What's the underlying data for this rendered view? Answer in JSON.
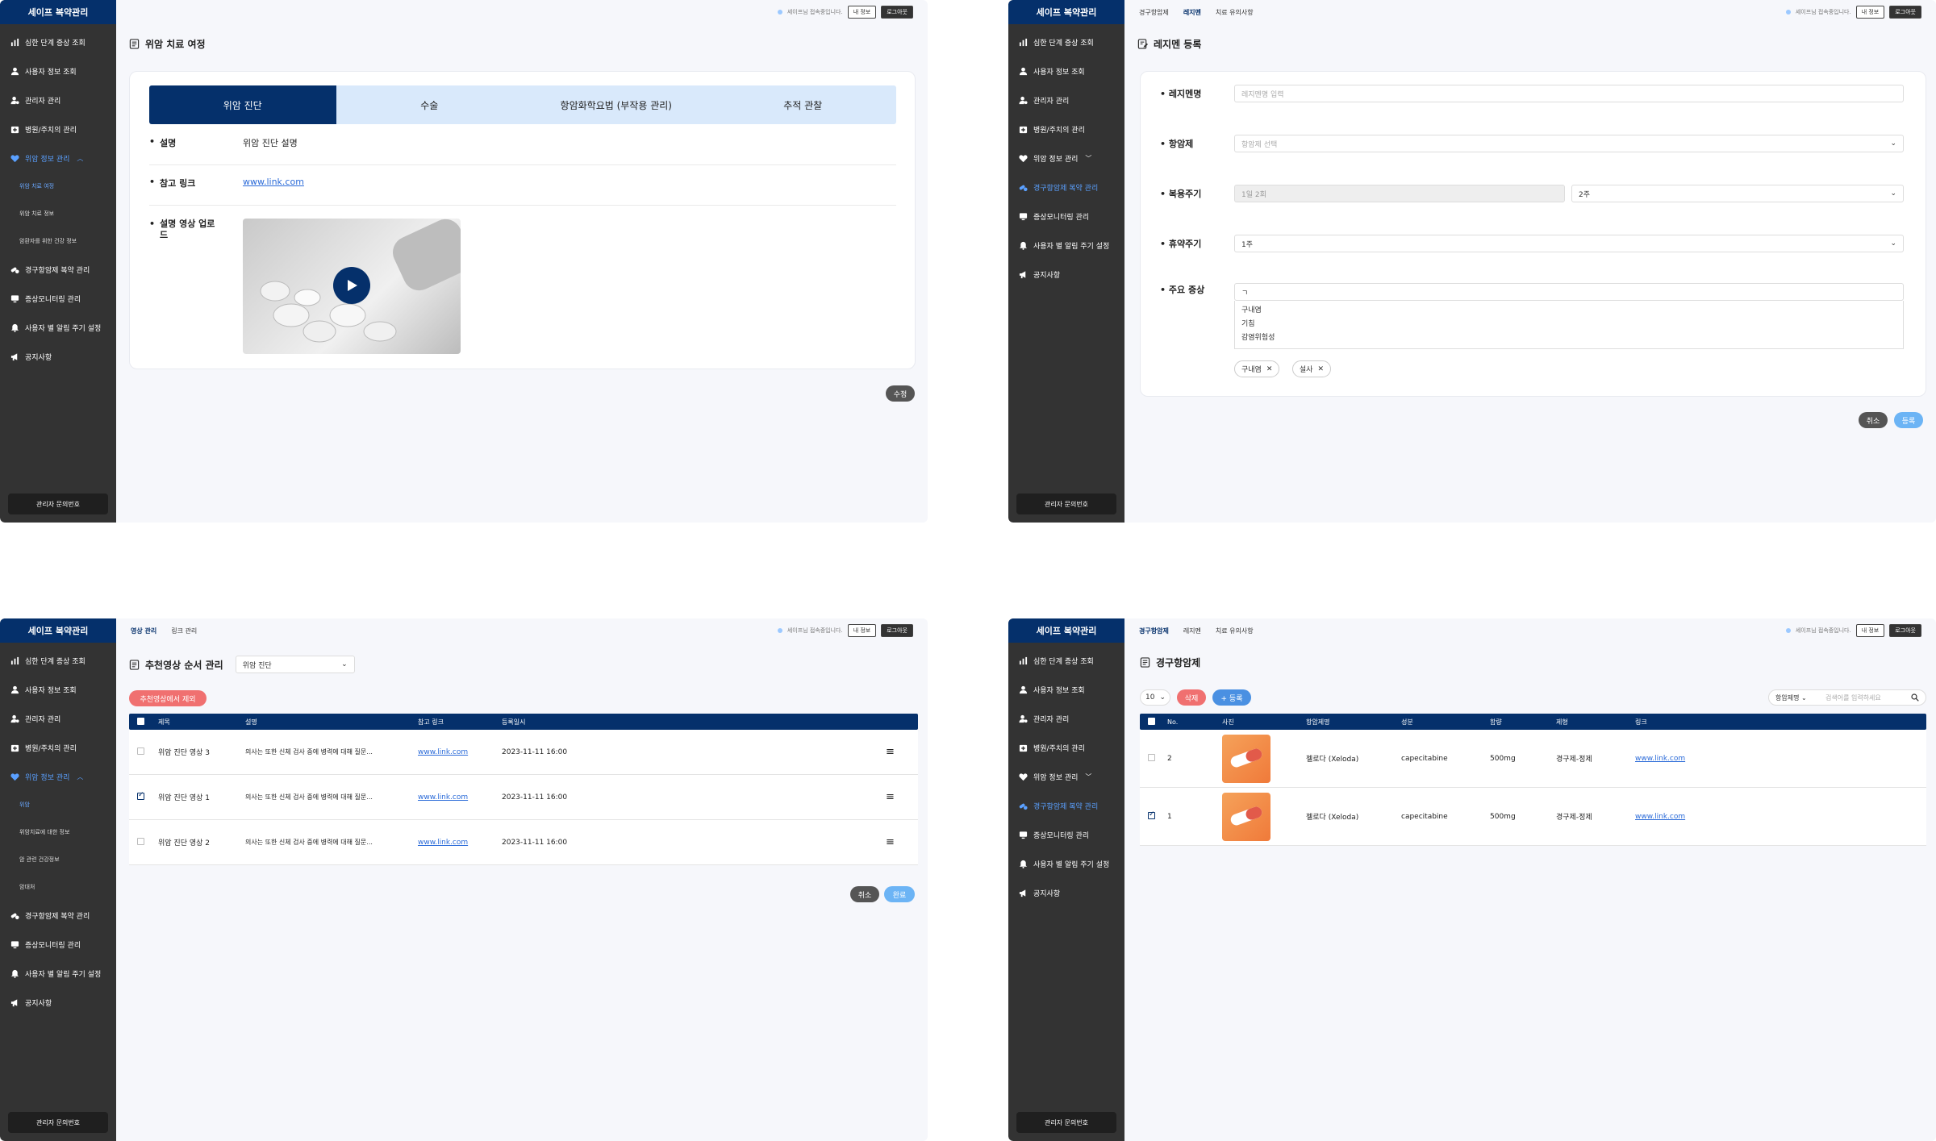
{
  "sidebar": {
    "brand": "세이프 복약관리",
    "items": [
      {
        "label": "심한 단계 증상 조회"
      },
      {
        "label": "사용자 정보 조회"
      },
      {
        "label": "관리자 관리"
      },
      {
        "label": "병원/주치의 관리"
      },
      {
        "label": "위암 정보 관리"
      },
      {
        "label": "경구항암제 복약 관리"
      },
      {
        "label": "증상모니터링 관리"
      },
      {
        "label": "사용자 별 알림 주기 설정"
      },
      {
        "label": "공지사항"
      }
    ],
    "submenu_p1": [
      "위암 치료 여정",
      "위암 치료 정보",
      "암환자를 위한 건강 정보"
    ],
    "submenu_p3": [
      "위암",
      "위암치료에 대한 정보",
      "암 관련 건강정보",
      "암대처"
    ],
    "footer": "관리자 문의번호"
  },
  "header": {
    "status": "세이프님 접속중입니다.",
    "my_info": "내 정보",
    "logout": "로그아웃"
  },
  "panel1": {
    "title": "위암 치료 여정",
    "tabs": [
      "위암 진단",
      "수술",
      "항암화학요법 (부작용 관리)",
      "추적 관찰"
    ],
    "desc_label": "설명",
    "desc_value": "위암 진단 설명",
    "link_label": "참고 링크",
    "link_value": "www.link.com",
    "video_label": "설명 영상 업로드",
    "edit": "수정"
  },
  "panel2": {
    "tabs": [
      "경구항암제",
      "레지멘",
      "치료 유의사항"
    ],
    "title": "레지멘 등록",
    "regimen_label": "레지멘명",
    "regimen_placeholder": "레지멘명 입력",
    "drug_label": "항암제",
    "drug_placeholder": "항암제 선택",
    "cycle_label": "복용주기",
    "cycle_value": "1일 2회",
    "cycle_select": "2주",
    "rest_label": "휴약주기",
    "rest_select": "1주",
    "symptom_label": "주요 증상",
    "symptom_input": "ㄱ",
    "suggestions": [
      "구내염",
      "기침",
      "감염위험성"
    ],
    "chips": [
      "구내염",
      "설사"
    ],
    "cancel": "취소",
    "submit": "등록"
  },
  "panel3": {
    "tabs": [
      "영상 관리",
      "링크 관리"
    ],
    "title": "추천영상 순서 관리",
    "select": "위암 진단",
    "exclude": "추천영상에서 제외",
    "columns": [
      "제목",
      "설명",
      "참고 링크",
      "등록일시"
    ],
    "rows": [
      {
        "title": "위암 진단 영상 3",
        "desc": "의사는 또한 신체 검사 중에 병력에 대해 질문...",
        "link": "www.link.com",
        "date": "2023-11-11 16:00",
        "checked": false
      },
      {
        "title": "위암 진단 영상 1",
        "desc": "의사는 또한 신체 검사 중에 병력에 대해 질문...",
        "link": "www.link.com",
        "date": "2023-11-11 16:00",
        "checked": true
      },
      {
        "title": "위암 진단 영상 2",
        "desc": "의사는 또한 신체 검사 중에 병력에 대해 질문...",
        "link": "www.link.com",
        "date": "2023-11-11 16:00",
        "checked": false
      }
    ],
    "cancel": "취소",
    "done": "완료"
  },
  "panel4": {
    "tabs": [
      "경구항암제",
      "레지멘",
      "치료 유의사항"
    ],
    "title": "경구항암제",
    "page_size": "10",
    "delete": "삭제",
    "add": "+ 등록",
    "search_select": "항암제명",
    "search_placeholder": "검색어를 입력하세요",
    "columns": [
      "No.",
      "사진",
      "항암제명",
      "성분",
      "함량",
      "제형",
      "링크"
    ],
    "rows": [
      {
        "no": "2",
        "name": "젤로다 (Xeloda)",
        "ingredient": "capecitabine",
        "dose": "500mg",
        "form": "경구제-정제",
        "link": "www.link.com",
        "checked": false
      },
      {
        "no": "1",
        "name": "젤로다 (Xeloda)",
        "ingredient": "capecitabine",
        "dose": "500mg",
        "form": "경구제-정제",
        "link": "www.link.com",
        "checked": true
      }
    ]
  }
}
